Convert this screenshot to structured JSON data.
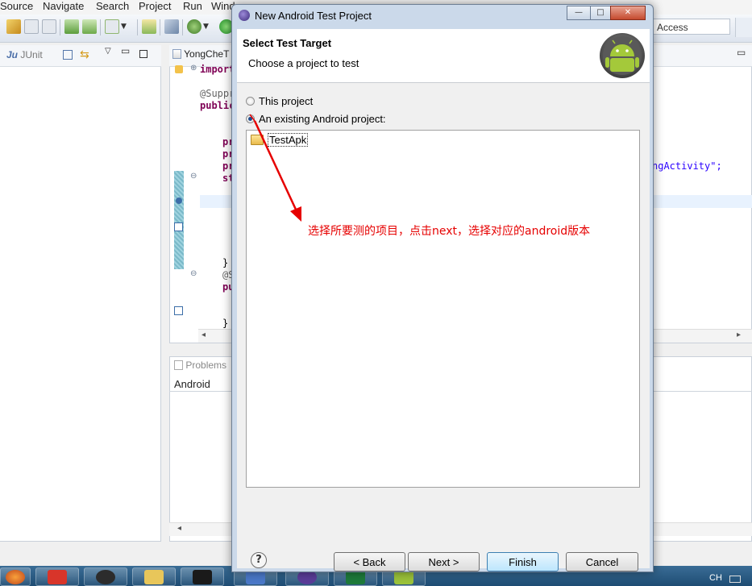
{
  "menubar": {
    "items": [
      "Source",
      "Navigate",
      "Search",
      "Project",
      "Run",
      "Wind"
    ]
  },
  "toolbar": {
    "quick_access_text": "Access"
  },
  "left_panel": {
    "junit_tab": "JUnit"
  },
  "editor": {
    "tab_label": "YongCheT",
    "lines": [
      {
        "kind": "kw",
        "text": "import"
      },
      {
        "kind": "ann",
        "text": "@Suppr"
      },
      {
        "kind": "kw",
        "text": "public"
      },
      {
        "kind": "kw",
        "text": "pr"
      },
      {
        "kind": "kw",
        "text": "pr"
      },
      {
        "kind": "kw",
        "text": "pr"
      },
      {
        "kind": "kw",
        "text": "st"
      },
      {
        "kind": "plain",
        "text": "}"
      },
      {
        "kind": "ann",
        "text": "@S"
      },
      {
        "kind": "kw",
        "text": "pu"
      },
      {
        "kind": "plain",
        "text": "}"
      }
    ],
    "right_fragment": "ngActivity\";"
  },
  "bottom_panel": {
    "problems_tab": "Problems",
    "android_label": "Android"
  },
  "dialog": {
    "title": "New Android Test Project",
    "header_title": "Select Test Target",
    "header_subtitle": "Choose a project to test",
    "radio_this_project": "This project",
    "radio_existing": "An existing Android project:",
    "selected_radio": "existing",
    "projects": [
      "TestApk"
    ],
    "buttons": {
      "help": "?",
      "back": "< Back",
      "next": "Next >",
      "finish": "Finish",
      "cancel": "Cancel"
    },
    "window_controls": {
      "minimize": "—",
      "maximize": "□",
      "close": "✕"
    }
  },
  "annotation": {
    "text": "选择所要测的项目，点击next，选择对应的android版本",
    "color": "#e60000"
  },
  "taskbar": {
    "lang": "CH",
    "item_colors": [
      "#d8352a",
      "#2c2c2c",
      "#e8c65a",
      "#1a1a1a",
      "#4a78c8",
      "#5a3c98",
      "#1e7a3a",
      "#9bc23a"
    ]
  }
}
